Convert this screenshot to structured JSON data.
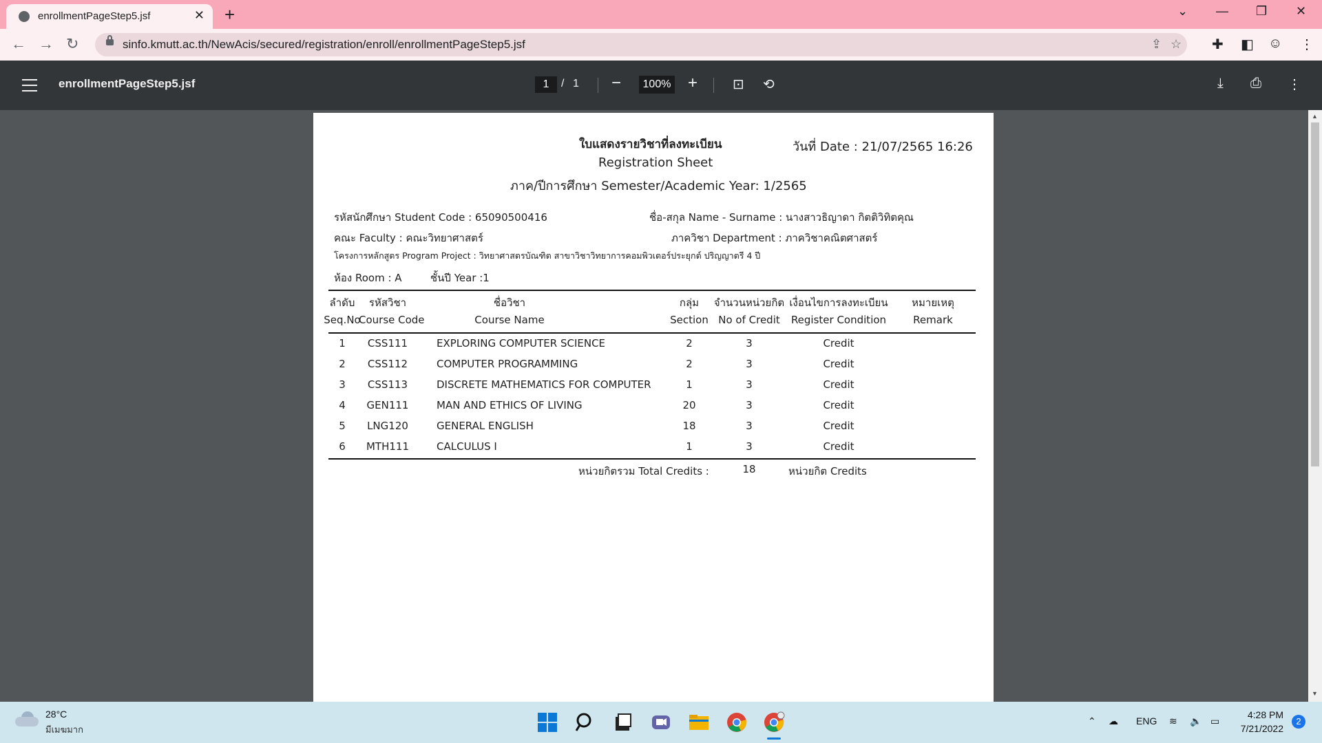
{
  "browser": {
    "tab_title": "enrollmentPageStep5.jsf",
    "url": "sinfo.kmutt.ac.th/NewAcis/secured/registration/enroll/enrollmentPageStep5.jsf"
  },
  "pdf_viewer": {
    "title": "enrollmentPageStep5.jsf",
    "current_page": "1",
    "page_sep": "/",
    "total_pages": "1",
    "zoom": "100%"
  },
  "document": {
    "title_th": "ใบแสดงรายวิชาที่ลงทะเบียน",
    "title_en": "Registration Sheet",
    "semester_line": "ภาค/ปีการศึกษา Semester/Academic Year: 1/2565",
    "date_line": "วันที่ Date : 21/07/2565 16:26",
    "student_code": "รหัสนักศึกษา Student Code : 65090500416",
    "name": "ชื่อ-สกุล Name - Surname : นางสาวธิญาดา กิตติวิทิตคุณ",
    "faculty": "คณะ  Faculty : คณะวิทยาศาสตร์",
    "department": "ภาควิชา Department : ภาควิชาคณิตศาสตร์",
    "program": "โครงการหลักสูตร Program Project : วิทยาศาสตรบัณฑิต สาขาวิชาวิทยาการคอมพิวเตอร์ประยุกต์ ปริญญาตรี 4 ปี",
    "room": "ห้อง Room  : A",
    "year": "ชั้นปี  Year :1",
    "headers": {
      "seq_th": "ลำดับ",
      "seq_en": "Seq.No",
      "code_th": "รหัสวิชา",
      "code_en": "Course Code",
      "name_th": "ชื่อวิชา",
      "name_en": "Course Name",
      "section_th": "กลุ่ม",
      "section_en": "Section",
      "credit_th": "จำนวนหน่วยกิต",
      "credit_en": "No of Credit",
      "cond_th": "เงื่อนไขการลงทะเบียน",
      "cond_en": "Register Condition",
      "remark_th": "หมายเหตุ",
      "remark_en": "Remark"
    },
    "rows": [
      {
        "seq": "1",
        "code": "CSS111",
        "name": "EXPLORING COMPUTER SCIENCE",
        "section": "2",
        "credit": "3",
        "condition": "Credit",
        "remark": ""
      },
      {
        "seq": "2",
        "code": "CSS112",
        "name": "COMPUTER PROGRAMMING",
        "section": "2",
        "credit": "3",
        "condition": "Credit",
        "remark": ""
      },
      {
        "seq": "3",
        "code": "CSS113",
        "name": "DISCRETE MATHEMATICS FOR COMPUTER",
        "section": "1",
        "credit": "3",
        "condition": "Credit",
        "remark": ""
      },
      {
        "seq": "4",
        "code": "GEN111",
        "name": "MAN AND ETHICS OF LIVING",
        "section": "20",
        "credit": "3",
        "condition": "Credit",
        "remark": ""
      },
      {
        "seq": "5",
        "code": "LNG120",
        "name": "GENERAL ENGLISH",
        "section": "18",
        "credit": "3",
        "condition": "Credit",
        "remark": ""
      },
      {
        "seq": "6",
        "code": "MTH111",
        "name": "CALCULUS I",
        "section": "1",
        "credit": "3",
        "condition": "Credit",
        "remark": ""
      }
    ],
    "total_label": "หน่วยกิตรวม Total Credits :",
    "total_value": "18",
    "total_unit": "หน่วยกิต Credits"
  },
  "taskbar": {
    "temperature": "28°C",
    "weather": "มีเมฆมาก",
    "language": "ENG",
    "time": "4:28 PM",
    "date": "7/21/2022",
    "notifications": "2"
  },
  "colors": {
    "tab_strip": "#f8a8b8",
    "pdf_toolbar": "#323639",
    "viewer_bg": "#525659",
    "taskbar": "#cfe6ef"
  }
}
